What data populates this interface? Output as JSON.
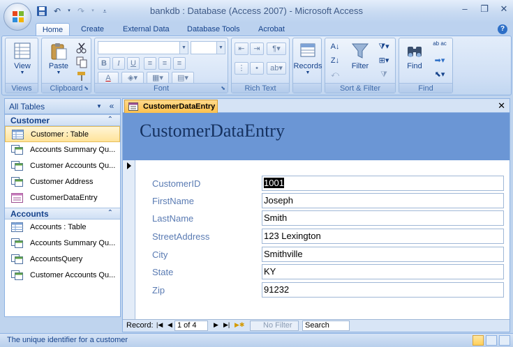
{
  "window": {
    "title": "bankdb : Database (Access 2007) - Microsoft Access",
    "controls": [
      "minimize-icon",
      "restore-icon",
      "close-icon"
    ]
  },
  "ribbon": {
    "tabs": [
      "Home",
      "Create",
      "External Data",
      "Database Tools",
      "Acrobat"
    ],
    "active_tab": "Home",
    "groups": {
      "views": {
        "label": "Views",
        "view_button": "View"
      },
      "clipboard": {
        "label": "Clipboard",
        "paste_button": "Paste"
      },
      "font": {
        "label": "Font",
        "bold": "B",
        "italic": "I",
        "underline": "U",
        "font_color": "A"
      },
      "richtext": {
        "label": "Rich Text"
      },
      "records": {
        "label": "",
        "records_button": "Records"
      },
      "sortfilter": {
        "label": "Sort & Filter",
        "filter_button": "Filter"
      },
      "find": {
        "label": "Find",
        "find_button": "Find",
        "replace_label": "ab ac"
      }
    }
  },
  "nav": {
    "header": "All Tables",
    "groups": [
      {
        "name": "Customer",
        "items": [
          {
            "label": "Customer : Table",
            "icon": "table-icon",
            "selected": true
          },
          {
            "label": "Accounts Summary Qu...",
            "icon": "query-icon"
          },
          {
            "label": "Customer Accounts Qu...",
            "icon": "query-icon"
          },
          {
            "label": "Customer Address",
            "icon": "query-icon"
          },
          {
            "label": "CustomerDataEntry",
            "icon": "form-icon"
          }
        ]
      },
      {
        "name": "Accounts",
        "items": [
          {
            "label": "Accounts : Table",
            "icon": "table-icon"
          },
          {
            "label": "Accounts Summary Qu...",
            "icon": "query-icon"
          },
          {
            "label": "AccountsQuery",
            "icon": "query-icon"
          },
          {
            "label": "Customer Accounts Qu...",
            "icon": "query-icon"
          }
        ]
      }
    ]
  },
  "document": {
    "tab_label": "CustomerDataEntry",
    "form_title": "CustomerDataEntry",
    "fields": [
      {
        "label": "CustomerID",
        "value": "1001"
      },
      {
        "label": "FirstName",
        "value": "Joseph"
      },
      {
        "label": "LastName",
        "value": "Smith"
      },
      {
        "label": "StreetAddress",
        "value": "123 Lexington"
      },
      {
        "label": "City",
        "value": "Smithville"
      },
      {
        "label": "State",
        "value": "KY"
      },
      {
        "label": "Zip",
        "value": "91232"
      }
    ],
    "record_nav": {
      "label": "Record:",
      "current": "1 of 4",
      "filter": "No Filter",
      "search": "Search"
    }
  },
  "status": {
    "text": "The unique identifier for a customer"
  },
  "colors": {
    "form_header": "#6b96d5",
    "accent": "#15428b",
    "tab_highlight": "#ffc14d"
  }
}
